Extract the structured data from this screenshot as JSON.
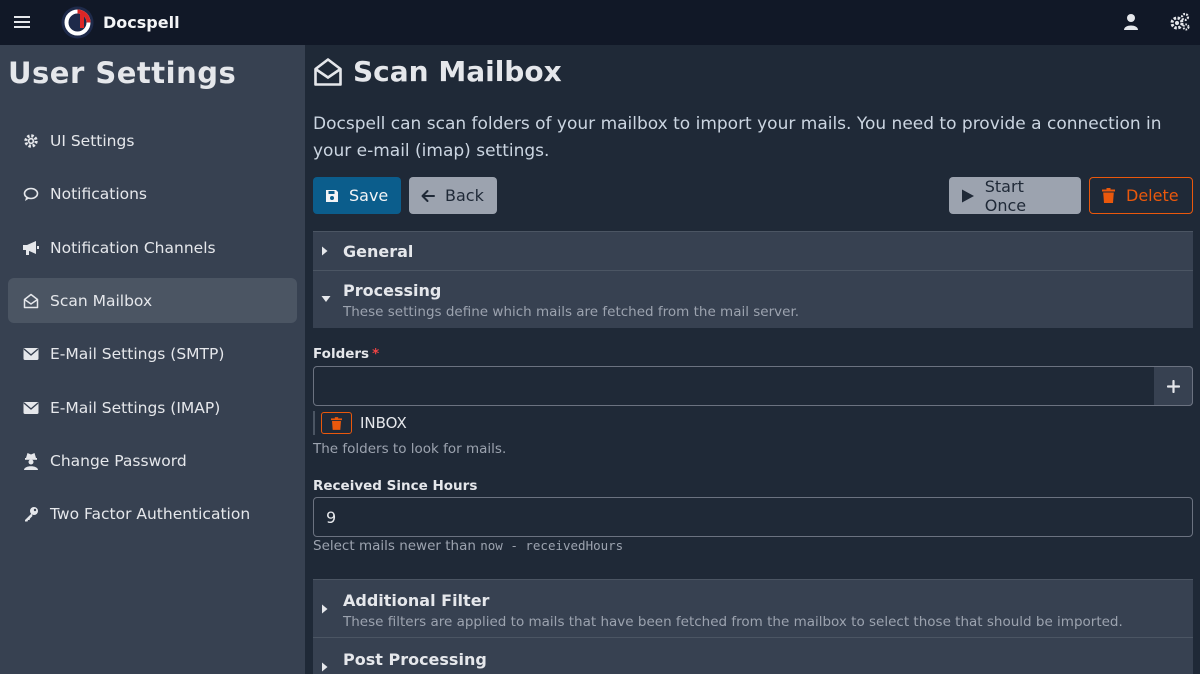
{
  "app": {
    "name": "Docspell"
  },
  "header": {
    "menu_icon": "hamburger-icon",
    "user_icon": "user-icon",
    "settings_icon": "cogs-icon"
  },
  "sidebar": {
    "title": "User Settings",
    "items": [
      {
        "label": "UI Settings",
        "icon": "cog-icon"
      },
      {
        "label": "Notifications",
        "icon": "comment-icon"
      },
      {
        "label": "Notification Channels",
        "icon": "bullhorn-icon"
      },
      {
        "label": "Scan Mailbox",
        "icon": "envelope-open-icon",
        "active": true
      },
      {
        "label": "E-Mail Settings (SMTP)",
        "icon": "envelope-icon"
      },
      {
        "label": "E-Mail Settings (IMAP)",
        "icon": "envelope-icon"
      },
      {
        "label": "Change Password",
        "icon": "user-secret-icon"
      },
      {
        "label": "Two Factor Authentication",
        "icon": "key-icon"
      }
    ]
  },
  "main": {
    "title": "Scan Mailbox",
    "intro": "Docspell can scan folders of your mailbox to import your mails. You need to provide a connection in your e-mail (imap) settings.",
    "buttons": {
      "save": "Save",
      "back": "Back",
      "start_once": "Start Once",
      "delete": "Delete"
    },
    "sections": {
      "general": {
        "title": "General"
      },
      "processing": {
        "title": "Processing",
        "description": "These settings define which mails are fetched from the mail server."
      },
      "additional_filter": {
        "title": "Additional Filter",
        "description": "These filters are applied to mails that have been fetched from the mailbox to select those that should be imported."
      },
      "post_processing": {
        "title": "Post Processing"
      }
    },
    "form": {
      "folders": {
        "label": "Folders",
        "required_mark": "*",
        "value": "",
        "items": [
          "INBOX"
        ],
        "help": "The folders to look for mails."
      },
      "received_since": {
        "label": "Received Since Hours",
        "value": "9",
        "help_prefix": "Select mails newer than",
        "help_code": "now - receivedHours"
      }
    }
  },
  "colors": {
    "primary": "#0b5d8c",
    "danger": "#ea580c",
    "sidebar_bg": "#374151",
    "topbar_bg": "#111827"
  }
}
